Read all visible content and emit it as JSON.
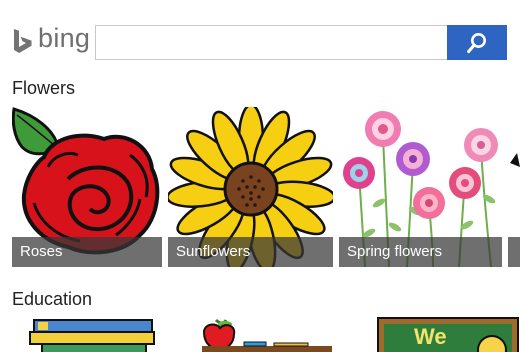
{
  "header": {
    "logo_text": "bing",
    "search": {
      "value": "",
      "placeholder": ""
    },
    "search_button_icon": "search-icon",
    "brand_color": "#2e64c2"
  },
  "sections": [
    {
      "title": "Flowers",
      "tiles": [
        {
          "caption": "Roses",
          "image": "red-rose-clipart"
        },
        {
          "caption": "Sunflowers",
          "image": "sunflower-clipart"
        },
        {
          "caption": "Spring flowers",
          "image": "spring-flowers-clipart"
        }
      ]
    },
    {
      "title": "Education",
      "tiles": [
        {
          "image": "stack-of-books-clipart"
        },
        {
          "image": "apple-on-desk-clipart"
        },
        {
          "image": "chalkboard-clipart",
          "text": "We"
        }
      ]
    }
  ]
}
